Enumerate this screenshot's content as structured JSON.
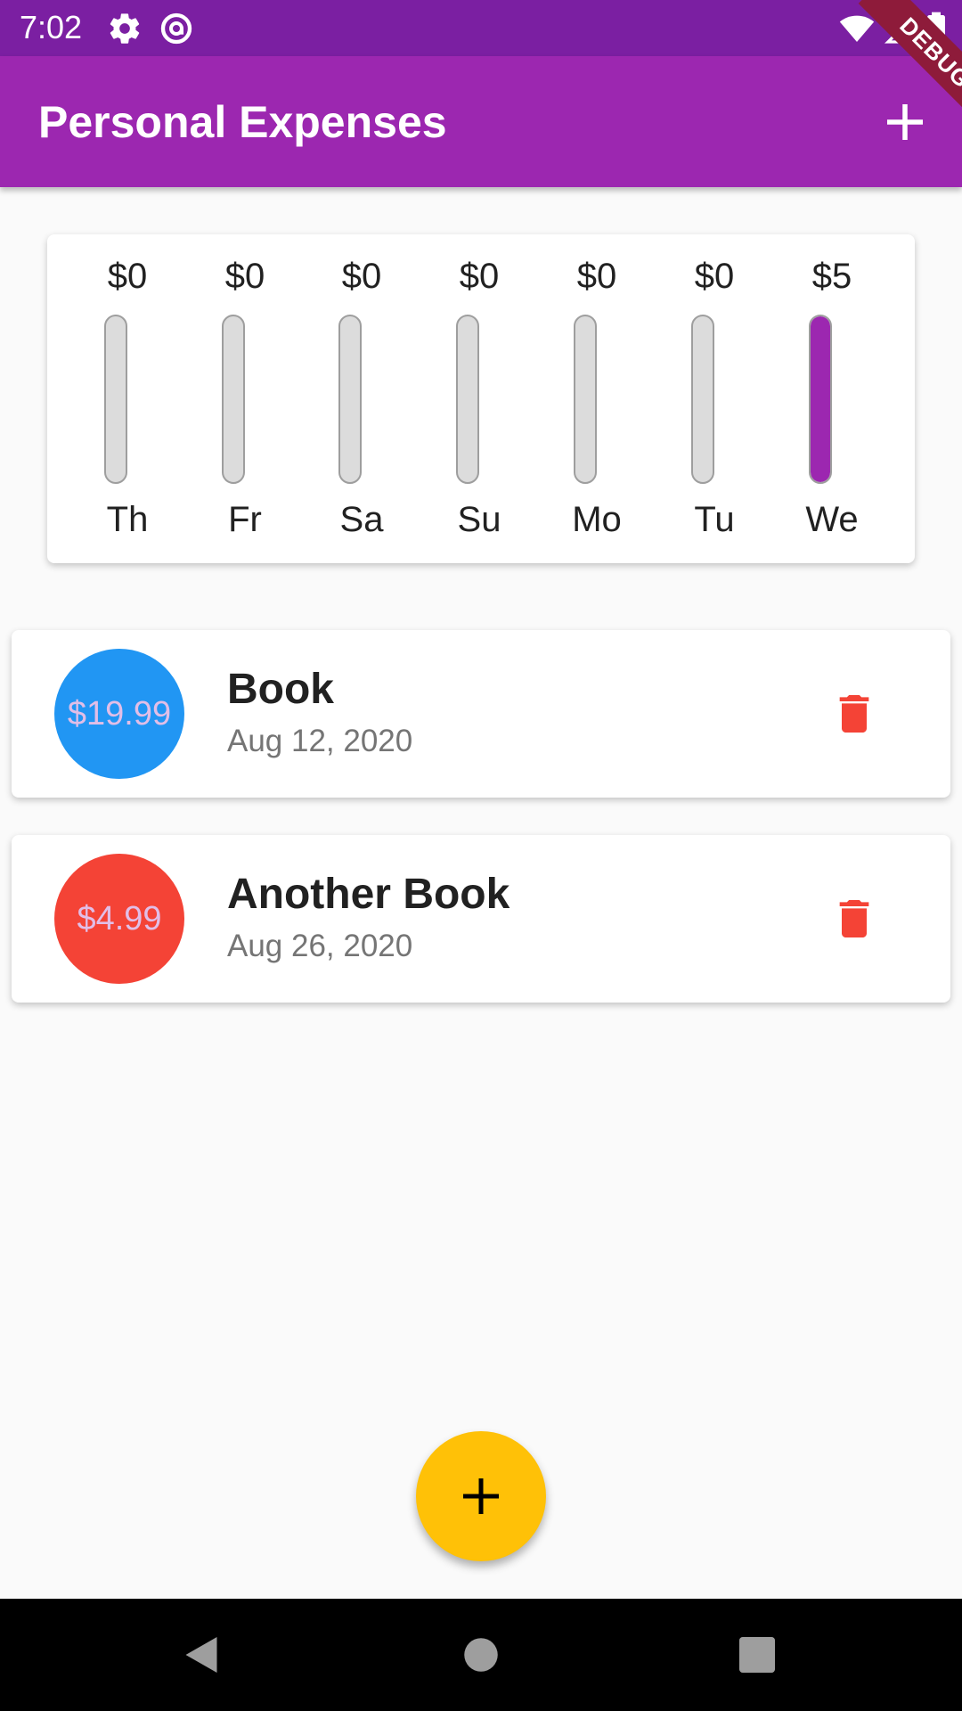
{
  "status_bar": {
    "time": "7:02",
    "icons": [
      "gear-icon",
      "at-sign-icon",
      "wifi-icon",
      "signal-icon",
      "battery-icon"
    ]
  },
  "app_bar": {
    "title": "Personal Expenses",
    "add_icon": "plus-icon"
  },
  "debug_banner": {
    "label": "DEBUG"
  },
  "chart": {
    "bars": [
      {
        "day": "Th",
        "amount": "$0",
        "fill": 0.0
      },
      {
        "day": "Fr",
        "amount": "$0",
        "fill": 0.0
      },
      {
        "day": "Sa",
        "amount": "$0",
        "fill": 0.0
      },
      {
        "day": "Su",
        "amount": "$0",
        "fill": 0.0
      },
      {
        "day": "Mo",
        "amount": "$0",
        "fill": 0.0
      },
      {
        "day": "Tu",
        "amount": "$0",
        "fill": 0.0
      },
      {
        "day": "We",
        "amount": "$5",
        "fill": 1.0
      }
    ]
  },
  "transactions": [
    {
      "amount": "$19.99",
      "title": "Book",
      "date": "Aug 12, 2020",
      "avatar_color": "#2196f3",
      "delete_icon": "trash-icon"
    },
    {
      "amount": "$4.99",
      "title": "Another Book",
      "date": "Aug 26, 2020",
      "avatar_color": "#f44336",
      "delete_icon": "trash-icon"
    }
  ],
  "fab": {
    "icon": "plus-icon"
  },
  "nav_bar": {
    "icons": [
      "back-icon",
      "home-icon",
      "recents-icon"
    ]
  },
  "colors": {
    "primary": "#9c27b0",
    "primary_dark": "#7b1fa2",
    "accent": "#ffc107",
    "error": "#f44336"
  }
}
